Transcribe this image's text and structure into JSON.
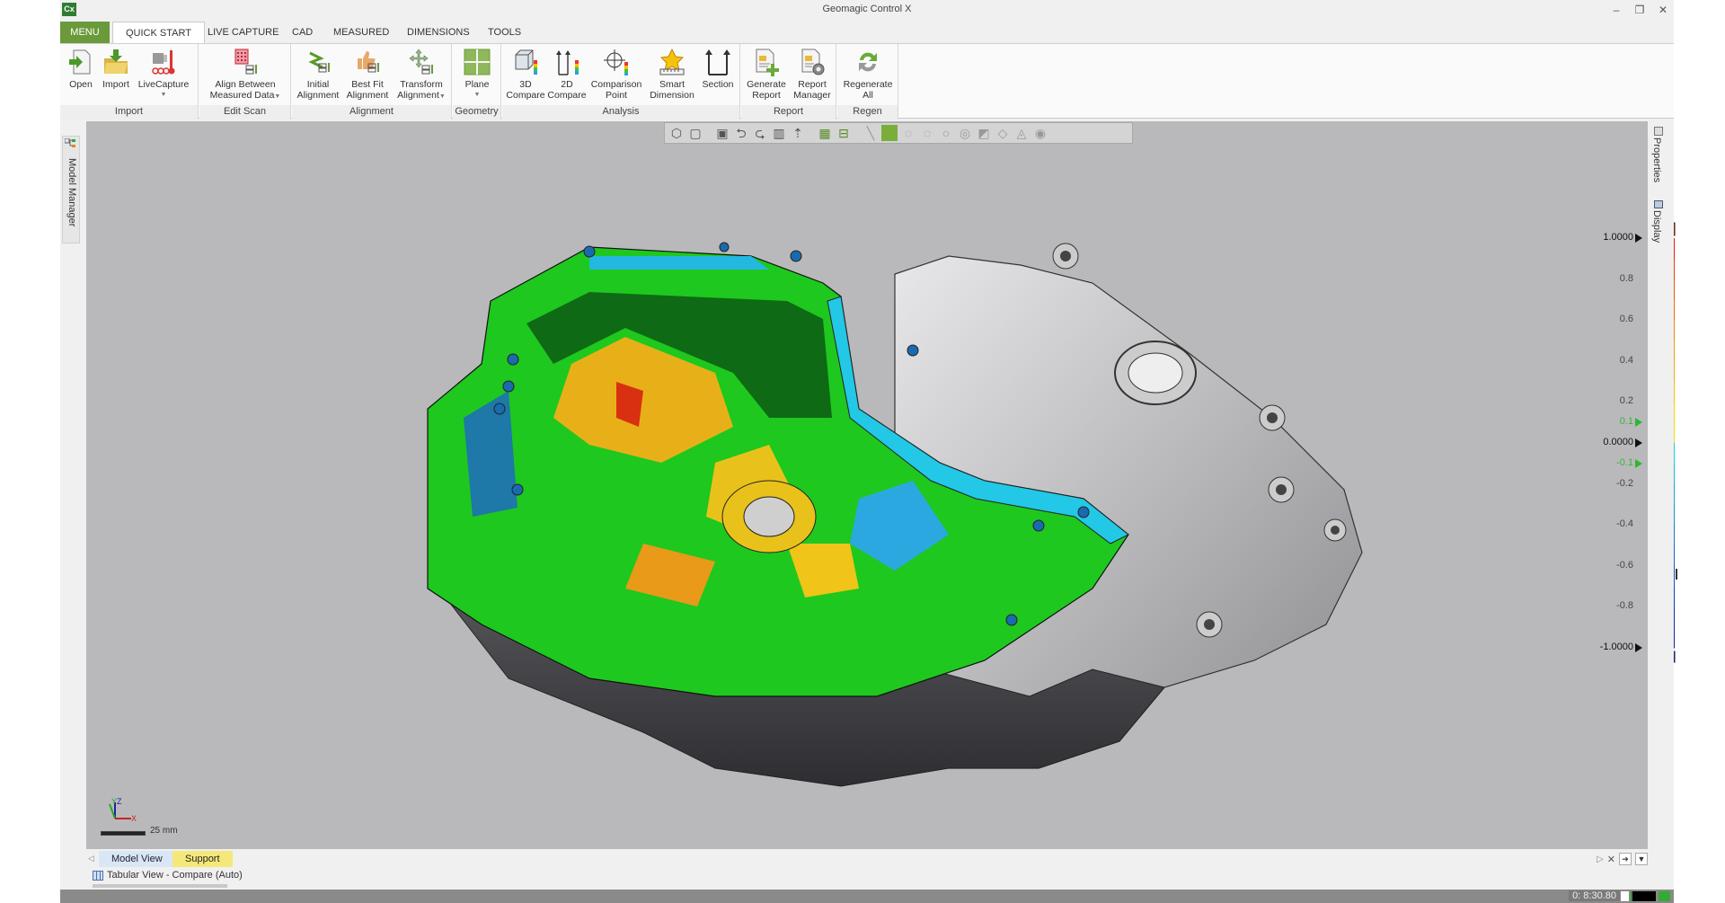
{
  "window": {
    "app_icon": "Cx",
    "title": "Geomagic Control X",
    "controls": {
      "minimize": "–",
      "restore": "❐",
      "close": "✕"
    }
  },
  "tabs": [
    {
      "label": "MENU"
    },
    {
      "label": "QUICK START",
      "active": true
    },
    {
      "label": "LIVE CAPTURE"
    },
    {
      "label": "CAD"
    },
    {
      "label": "MEASURED"
    },
    {
      "label": "DIMENSIONS"
    },
    {
      "label": "TOOLS"
    }
  ],
  "ribbon": {
    "groups": [
      {
        "label": "Import",
        "buttons": [
          {
            "label": "Open",
            "icon": "open-file-icon"
          },
          {
            "label": "Import",
            "icon": "import-folder-icon"
          },
          {
            "label": "LiveCapture",
            "icon": "live-capture-icon",
            "dropdown": true
          }
        ]
      },
      {
        "label": "Edit Scan",
        "buttons": [
          {
            "label": "Align Between",
            "label2": "Measured Data",
            "icon": "align-between-icon",
            "dropdown": true
          }
        ]
      },
      {
        "label": "Alignment",
        "buttons": [
          {
            "label": "Initial",
            "label2": "Alignment",
            "icon": "initial-alignment-icon"
          },
          {
            "label": "Best Fit",
            "label2": "Alignment",
            "icon": "best-fit-alignment-icon"
          },
          {
            "label": "Transform",
            "label2": "Alignment",
            "icon": "transform-alignment-icon",
            "dropdown": true
          }
        ]
      },
      {
        "label": "Geometry",
        "buttons": [
          {
            "label": "Plane",
            "icon": "plane-icon",
            "dropdown": true
          }
        ]
      },
      {
        "label": "Analysis",
        "buttons": [
          {
            "label": "3D",
            "label2": "Compare",
            "icon": "3d-compare-icon"
          },
          {
            "label": "2D",
            "label2": "Compare",
            "icon": "2d-compare-icon"
          },
          {
            "label": "Comparison",
            "label2": "Point",
            "icon": "comparison-point-icon"
          },
          {
            "label": "Smart",
            "label2": "Dimension",
            "icon": "smart-dimension-icon"
          },
          {
            "label": "Section",
            "icon": "section-icon"
          }
        ]
      },
      {
        "label": "Report",
        "buttons": [
          {
            "label": "Generate",
            "label2": "Report",
            "icon": "generate-report-icon"
          },
          {
            "label": "Report",
            "label2": "Manager",
            "icon": "report-manager-icon"
          }
        ]
      },
      {
        "label": "Regen",
        "buttons": [
          {
            "label": "Regenerate",
            "label2": "All",
            "icon": "regenerate-icon"
          }
        ]
      }
    ]
  },
  "side_panels": {
    "left": "Model Manager",
    "right": [
      "Properties",
      "Display"
    ]
  },
  "view_toolbar": [
    "render-mode-icon",
    "view-cube-icon",
    "isometric-view-icon",
    "rotate-left-view-icon",
    "rotate-right-view-icon",
    "split-view-icon",
    "fit-view-icon",
    "grid-select-icon",
    "compare-select-icon",
    "line-select-icon",
    "rect-select-icon",
    "circle-select-icon",
    "circle-select2-icon",
    "lasso-select-icon",
    "brush-select-icon",
    "select-through-icon",
    "hide-icon",
    "show-icon",
    "visibility-icon"
  ],
  "color_legend": {
    "max_label": "1.0000",
    "min_label": "-1.0000",
    "zero_label": "0.0000",
    "tolerance_upper": "0.1",
    "tolerance_lower": "-0.1",
    "tick_labels": [
      "0.8",
      "0.6",
      "0.4",
      "0.2",
      "-0.2",
      "-0.4",
      "-0.6",
      "-0.8"
    ],
    "over_color": "#ff1a0a",
    "under_color": "#0a1aff",
    "tolerance_color": "#14c814",
    "positive_colors": [
      "#f21c0a",
      "#ea3d0a",
      "#ec550a",
      "#ee6e0a",
      "#f0880a",
      "#f09d0a",
      "#f0b00a",
      "#f0c40a",
      "#f2d60a",
      "#f0e00a"
    ],
    "negative_colors": [
      "#10d4e6",
      "#10bde0",
      "#12a6da",
      "#1290d0",
      "#147ac8",
      "#1666c0",
      "#1652b8",
      "#163eb0",
      "#162ca6",
      "#16209e"
    ]
  },
  "scale_bar": {
    "label": "25 mm"
  },
  "axis_triad": {
    "x": "X",
    "y": "Y",
    "z": "Z"
  },
  "bottom_tabs": [
    {
      "label": "Model View"
    },
    {
      "label": "Support"
    }
  ],
  "tabular_view": {
    "label": "Tabular View - Compare (Auto)"
  },
  "status": {
    "time": "0: 8:30.80"
  },
  "colors": {
    "accent_green": "#6a9a3a",
    "viewport_bg": "#b9b9bb"
  }
}
